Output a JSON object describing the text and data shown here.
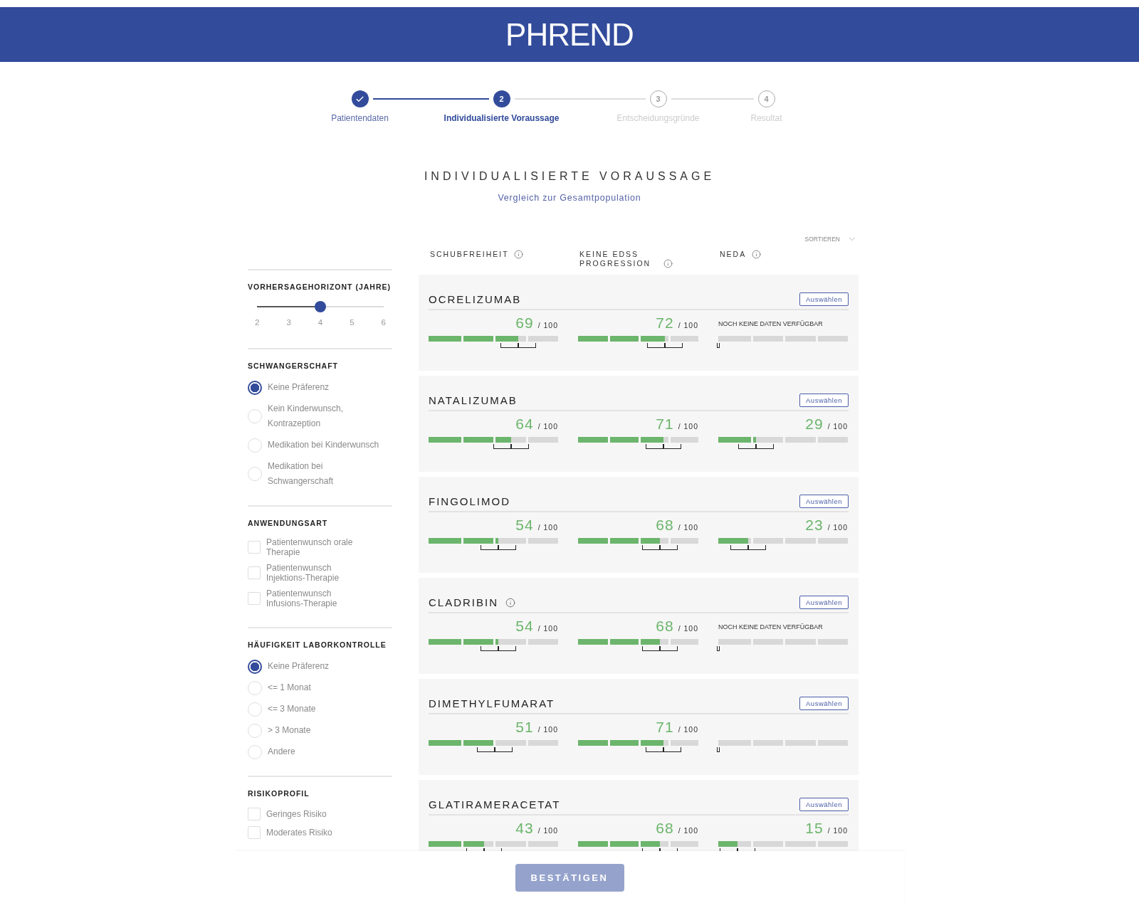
{
  "header": {
    "logo": "PHREND"
  },
  "stepper": [
    {
      "label": "Patientendaten",
      "completed": true,
      "selected": false
    },
    {
      "number": "2",
      "label": "Individualisierte Voraussage",
      "completed": false,
      "selected": true
    },
    {
      "number": "3",
      "label": "Entscheidungsgründe",
      "completed": false,
      "selected": false
    },
    {
      "number": "4",
      "label": "Resultat",
      "completed": false,
      "selected": false
    }
  ],
  "title": "INDIVIDUALISIERTE VORAUSSAGE",
  "subtitle_link": "Vergleich zur Gesamtpopulation",
  "sort": {
    "label": "SORTIEREN"
  },
  "sidebar": [
    {
      "kind": "slider",
      "heading": "VORHERSAGEHORIZONT (JAHRE)",
      "level": 0.5,
      "ticks": [
        "2",
        "3",
        "4",
        "5",
        "6"
      ]
    },
    {
      "kind": "radio",
      "heading": "SCHWANGERSCHAFT",
      "options": [
        {
          "label": "Keine Präferenz",
          "selected": true
        },
        {
          "label": "Kein Kinderwunsch, Kontrazeption",
          "selected": false
        },
        {
          "label": "Medikation bei Kinderwunsch",
          "selected": false
        },
        {
          "label": "Medikation bei Schwangerschaft",
          "selected": false
        }
      ]
    },
    {
      "kind": "checkbox",
      "heading": "ANWENDUNGSART",
      "options": [
        {
          "label": "Patientenwunsch orale Therapie",
          "checked": false
        },
        {
          "label": "Patientenwunsch Injektions-Therapie",
          "checked": false
        },
        {
          "label": "Patientenwunsch Infusions-Therapie",
          "checked": false
        }
      ]
    },
    {
      "kind": "radio",
      "heading": "HÄUFIGKEIT LABORKONTROLLE",
      "options": [
        {
          "label": "Keine Präferenz",
          "selected": true
        },
        {
          "label": "<= 1 Monat",
          "selected": false
        },
        {
          "label": "<= 3 Monate",
          "selected": false
        },
        {
          "label": "> 3 Monate",
          "selected": false
        },
        {
          "label": "Andere",
          "selected": false
        }
      ]
    },
    {
      "kind": "checkbox",
      "heading": "RISIKOPROFIL",
      "options": [
        {
          "label": "Geringes Risiko",
          "checked": false
        },
        {
          "label": "Moderates Risiko",
          "checked": false
        }
      ]
    }
  ],
  "columns": [
    {
      "label": "SCHUBFREIHEIT"
    },
    {
      "label": "KEINE EDSS PROGRESSION"
    },
    {
      "label": "NEDA"
    }
  ],
  "treatments": [
    {
      "name": "OCRELIZUMAB",
      "info": false,
      "button": "Auswählen",
      "metrics": [
        {
          "kind": "score",
          "value": "69",
          "max": "/ 100",
          "level": 0.69
        },
        {
          "kind": "score",
          "value": "72",
          "max": "/ 100",
          "level": 0.72
        },
        {
          "kind": "nodata",
          "note": "NOCH KEINE DATEN VERFÜGBAR"
        }
      ]
    },
    {
      "name": "NATALIZUMAB",
      "info": false,
      "button": "Auswählen",
      "metrics": [
        {
          "kind": "score",
          "value": "64",
          "max": "/ 100",
          "level": 0.64
        },
        {
          "kind": "score",
          "value": "71",
          "max": "/ 100",
          "level": 0.71
        },
        {
          "kind": "score",
          "value": "29",
          "max": "/ 100",
          "level": 0.29
        }
      ]
    },
    {
      "name": "FINGOLIMOD",
      "info": false,
      "button": "Auswählen",
      "metrics": [
        {
          "kind": "score",
          "value": "54",
          "max": "/ 100",
          "level": 0.54
        },
        {
          "kind": "score",
          "value": "68",
          "max": "/ 100",
          "level": 0.68
        },
        {
          "kind": "score",
          "value": "23",
          "max": "/ 100",
          "level": 0.23
        }
      ]
    },
    {
      "name": "CLADRIBIN",
      "info": true,
      "button": "Auswählen",
      "metrics": [
        {
          "kind": "score",
          "value": "54",
          "max": "/ 100",
          "level": 0.54
        },
        {
          "kind": "score",
          "value": "68",
          "max": "/ 100",
          "level": 0.68
        },
        {
          "kind": "nodata",
          "note": "NOCH KEINE DATEN VERFÜGBAR"
        }
      ]
    },
    {
      "name": "DIMETHYLFUMARAT",
      "info": false,
      "button": "Auswählen",
      "metrics": [
        {
          "kind": "score",
          "value": "51",
          "max": "/ 100",
          "level": 0.51
        },
        {
          "kind": "score",
          "value": "71",
          "max": "/ 100",
          "level": 0.71
        },
        {
          "kind": "nodata"
        }
      ]
    },
    {
      "name": "GLATIRAMERACETAT",
      "info": false,
      "button": "Auswählen",
      "metrics": [
        {
          "kind": "score",
          "value": "43",
          "max": "/ 100",
          "level": 0.43
        },
        {
          "kind": "score",
          "value": "68",
          "max": "/ 100",
          "level": 0.68
        },
        {
          "kind": "score",
          "value": "15",
          "max": "/ 100",
          "level": 0.15
        }
      ]
    }
  ],
  "confirm_button": {
    "label": "BESTÄTIGEN",
    "disabled": true
  }
}
